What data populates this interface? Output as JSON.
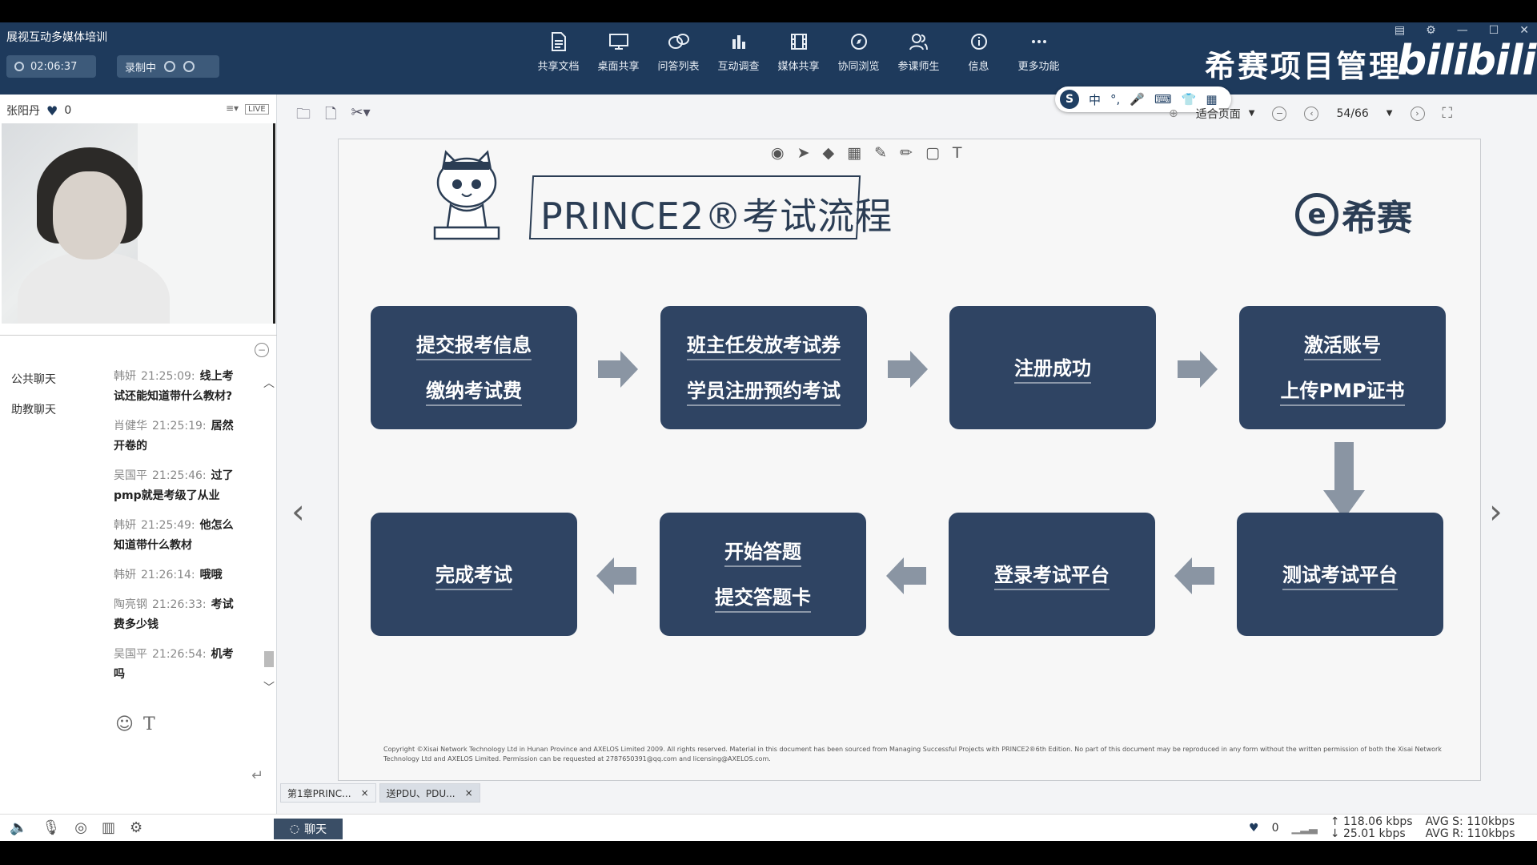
{
  "app": {
    "title": "展视互动多媒体培训"
  },
  "header": {
    "timer": "02:06:37",
    "recording": "录制中",
    "tools": [
      {
        "label": "共享文档",
        "icon": "document-icon"
      },
      {
        "label": "桌面共享",
        "icon": "desktop-icon"
      },
      {
        "label": "问答列表",
        "icon": "qa-icon"
      },
      {
        "label": "互动调查",
        "icon": "chart-icon"
      },
      {
        "label": "媒体共享",
        "icon": "film-icon"
      },
      {
        "label": "协同浏览",
        "icon": "compass-icon"
      },
      {
        "label": "参课师生",
        "icon": "users-icon"
      },
      {
        "label": "信息",
        "icon": "info-icon"
      },
      {
        "label": "更多功能",
        "icon": "more-icon"
      }
    ],
    "brand": "希赛项目管理",
    "watermark": "bilibili"
  },
  "ime": {
    "logo": "S",
    "items": [
      "中",
      "°,",
      "🎤",
      "⌨",
      "👕",
      "▦"
    ]
  },
  "left": {
    "presenter": "张阳丹",
    "likes": "0",
    "live": "LIVE",
    "chat_tabs": [
      "公共聊天",
      "助教聊天"
    ],
    "messages": [
      {
        "who": "韩妍",
        "time": "21:25:09:",
        "text": "线上考试还能知道带什么教材?"
      },
      {
        "who": "肖健华",
        "time": "21:25:19:",
        "text": "居然开卷的"
      },
      {
        "who": "吴国平",
        "time": "21:25:46:",
        "text": "过了pmp就是考级了从业"
      },
      {
        "who": "韩妍",
        "time": "21:25:49:",
        "text": "他怎么知道带什么教材"
      },
      {
        "who": "韩妍",
        "time": "21:26:14:",
        "text": "哦哦"
      },
      {
        "who": "陶亮钢",
        "time": "21:26:33:",
        "text": "考试费多少钱"
      },
      {
        "who": "吴国平",
        "time": "21:26:54:",
        "text": "机考吗"
      }
    ]
  },
  "doc": {
    "zoom": "适合页面",
    "page": "54/66",
    "tabs": [
      "第1章PRINC...",
      "送PDU、PDU..."
    ]
  },
  "slide": {
    "title": "PRINCE2®考试流程",
    "logo": "希赛",
    "steps": [
      {
        "lines": [
          "提交报考信息",
          "缴纳考试费"
        ]
      },
      {
        "lines": [
          "班主任发放考试券",
          "学员注册预约考试"
        ]
      },
      {
        "lines": [
          "注册成功"
        ]
      },
      {
        "lines": [
          "激活账号",
          "上传PMP证书"
        ]
      },
      {
        "lines": [
          "测试考试平台"
        ]
      },
      {
        "lines": [
          "登录考试平台"
        ]
      },
      {
        "lines": [
          "开始答题",
          "提交答题卡"
        ]
      },
      {
        "lines": [
          "完成考试"
        ]
      }
    ],
    "copyright": "Copyright ©Xisai Network Technology Ltd in Hunan Province and AXELOS Limited 2009. All rights reserved. Material in this document has been sourced from Managing Successful Projects with PRINCE2®6th Edition. No part of this document may be reproduced in any form without the written permission of both the Xisai Network Technology Ltd and AXELOS Limited. Permission can be requested at 2787650391@qq.com and licensing@AXELOS.com."
  },
  "status": {
    "chat_button": "聊天",
    "likes": "0",
    "up_rate": "118.06 kbps",
    "down_rate": "25.01 kbps",
    "avg_s": "AVG S: 110kbps",
    "avg_r": "AVG R: 110kbps"
  },
  "colors": {
    "header_bg": "#1e3a5c",
    "step_bg": "#2f4463",
    "arrow": "#8a95a3"
  }
}
